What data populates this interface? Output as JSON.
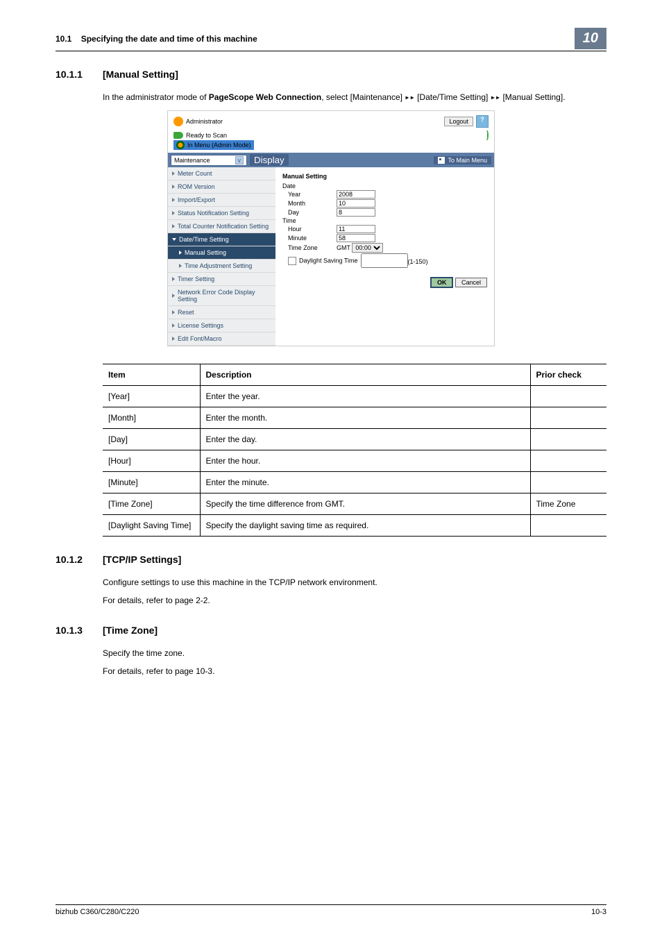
{
  "header": {
    "section_number": "10.1",
    "section_title": "Specifying the date and time of this machine",
    "chapter_number": "10"
  },
  "sections": [
    {
      "number": "10.1.1",
      "title": "[Manual Setting]",
      "paragraphs": [
        "In the administrator mode of PageScope Web Connection, select [Maintenance] ▸▸ [Date/Time Setting] ▸▸ [Manual Setting]."
      ]
    },
    {
      "number": "10.1.2",
      "title": "[TCP/IP Settings]",
      "paragraphs": [
        "Configure settings to use this machine in the TCP/IP network environment.",
        "For details, refer to page 2-2."
      ]
    },
    {
      "number": "10.1.3",
      "title": "[Time Zone]",
      "paragraphs": [
        "Specify the time zone.",
        "For details, refer to page 10-3."
      ]
    }
  ],
  "pagescope": {
    "role": "Administrator",
    "logout": "Logout",
    "help": "?",
    "status_ready": "Ready to Scan",
    "status_menu": "In Menu (Admin Mode)",
    "nav": {
      "dropdown": "Maintenance",
      "display_btn": "Display",
      "main_menu": "To Main Menu"
    },
    "sidebar": [
      "Meter Count",
      "ROM Version",
      "Import/Export",
      "Status Notification Setting",
      "Total Counter Notification Setting",
      "Date/Time Setting",
      "Manual Setting",
      "Time Adjustment Setting",
      "Timer Setting",
      "Network Error Code Display Setting",
      "Reset",
      "License Settings",
      "Edit Font/Macro"
    ],
    "form": {
      "title": "Manual Setting",
      "date_label": "Date",
      "year_label": "Year",
      "year_value": "2008",
      "month_label": "Month",
      "month_value": "10",
      "day_label": "Day",
      "day_value": "8",
      "time_label": "Time",
      "hour_label": "Hour",
      "hour_value": "11",
      "minute_label": "Minute",
      "minute_value": "58",
      "tz_label": "Time Zone",
      "tz_prefix": "GMT",
      "tz_value": "00:00",
      "dst_label": "Daylight Saving Time",
      "dst_range": "(1-150)",
      "ok": "OK",
      "cancel": "Cancel"
    }
  },
  "table": {
    "headers": [
      "Item",
      "Description",
      "Prior check"
    ],
    "rows": [
      {
        "item": "[Year]",
        "desc": "Enter the year.",
        "prior": ""
      },
      {
        "item": "[Month]",
        "desc": "Enter the month.",
        "prior": ""
      },
      {
        "item": "[Day]",
        "desc": "Enter the day.",
        "prior": ""
      },
      {
        "item": "[Hour]",
        "desc": "Enter the hour.",
        "prior": ""
      },
      {
        "item": "[Minute]",
        "desc": "Enter the minute.",
        "prior": ""
      },
      {
        "item": "[Time Zone]",
        "desc": "Specify the time difference from GMT.",
        "prior": "Time Zone"
      },
      {
        "item": "[Daylight Saving Time]",
        "desc": "Specify the daylight saving time as required.",
        "prior": ""
      }
    ]
  },
  "footer": {
    "model": "bizhub C360/C280/C220",
    "page": "10-3"
  },
  "text": {
    "bold_product": "PageScope Web Connection"
  }
}
